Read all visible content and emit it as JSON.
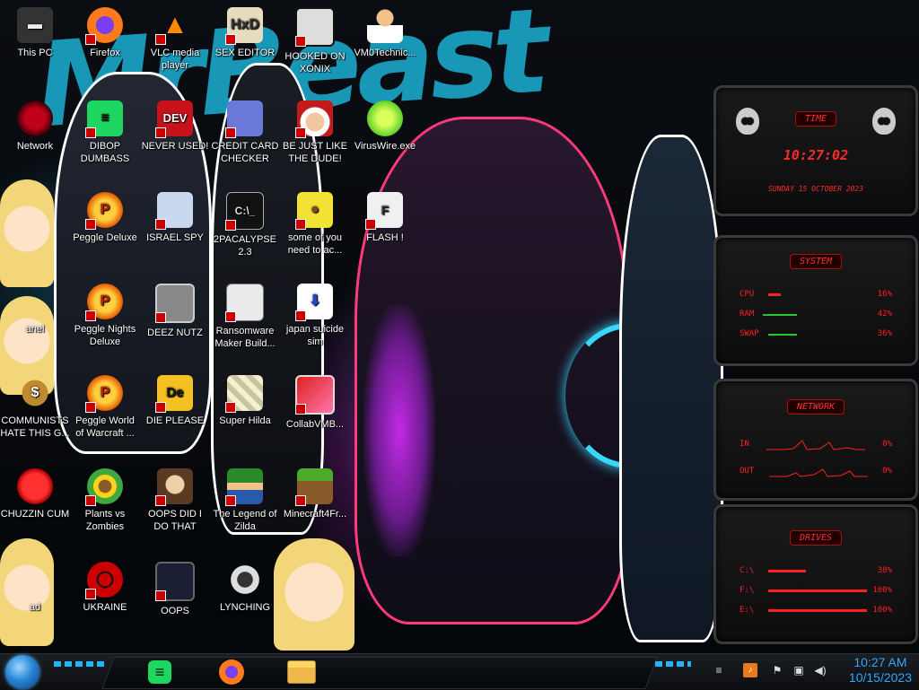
{
  "wallpaper": {
    "title_text": "MrBeast"
  },
  "desktop_icons": [
    {
      "id": "this-pc",
      "label": "This PC",
      "x": 0
    },
    {
      "id": "firefox",
      "label": "Firefox"
    },
    {
      "id": "vlc",
      "label": "VLC media player"
    },
    {
      "id": "sex-editor",
      "label": "SEX EDITOR"
    },
    {
      "id": "hooked-on-xonix",
      "label": "HOOKED ON XONIX"
    },
    {
      "id": "vm0technic",
      "label": "VM0Technic..."
    },
    {
      "id": "network",
      "label": "Network"
    },
    {
      "id": "dibop",
      "label": "DIBOP DUMBASS"
    },
    {
      "id": "never-used",
      "label": "NEVER USED!"
    },
    {
      "id": "credit-card",
      "label": "CREDIT CARD CHECKER"
    },
    {
      "id": "be-just-like",
      "label": "BE JUST LIKE THE DUDE!"
    },
    {
      "id": "viruswire",
      "label": "VirusWire.exe"
    },
    {
      "id": "peggle-deluxe",
      "label": "Peggle Deluxe"
    },
    {
      "id": "israel-spy",
      "label": "ISRAEL SPY"
    },
    {
      "id": "2pacalypse",
      "label": "2PACALYPSE 2.3"
    },
    {
      "id": "some-of-you",
      "label": "some of you need to ac..."
    },
    {
      "id": "flash",
      "label": "FLASH !"
    },
    {
      "id": "panel",
      "label": "anel"
    },
    {
      "id": "peggle-nights",
      "label": "Peggle Nights Deluxe"
    },
    {
      "id": "deez-nutz",
      "label": "DEEZ NUTZ"
    },
    {
      "id": "ransomware",
      "label": "Ransomware Maker Build..."
    },
    {
      "id": "japan-suicide",
      "label": "japan suicide sim"
    },
    {
      "id": "communists",
      "label": "COMMUNISTS HATE THIS G..."
    },
    {
      "id": "peggle-world",
      "label": "Peggle World of Warcraft ..."
    },
    {
      "id": "die-please",
      "label": "DIE PLEASE"
    },
    {
      "id": "super-hilda",
      "label": "Super Hilda"
    },
    {
      "id": "collabvmb",
      "label": "CollabVMB..."
    },
    {
      "id": "chuzzin",
      "label": "CHUZZIN CUM"
    },
    {
      "id": "pvz",
      "label": "Plants vs Zombies"
    },
    {
      "id": "oops-did",
      "label": "OOPS DID I DO THAT"
    },
    {
      "id": "zilda",
      "label": "The Legend of Zilda"
    },
    {
      "id": "minecraft",
      "label": "Minecraft4Fr..."
    },
    {
      "id": "ad",
      "label": "ad"
    },
    {
      "id": "ukraine",
      "label": "UKRAINE"
    },
    {
      "id": "oops",
      "label": "OOPS"
    },
    {
      "id": "lynching",
      "label": "LYNCHING"
    }
  ],
  "gadgets": {
    "time": {
      "title": "TIME",
      "clock": "10:27:02",
      "date": "SUNDAY 15 OCTOBER 2023"
    },
    "system": {
      "title": "SYSTEM",
      "rows": [
        {
          "label": "CPU",
          "value": "16%",
          "fill": 0.16
        },
        {
          "label": "RAM",
          "value": "42%",
          "fill": 0.42
        },
        {
          "label": "SWAP",
          "value": "36%",
          "fill": 0.36
        }
      ]
    },
    "network": {
      "title": "NETWORK",
      "rows": [
        {
          "label": "IN",
          "value": "0%"
        },
        {
          "label": "OUT",
          "value": "0%"
        }
      ]
    },
    "drives": {
      "title": "DRIVES",
      "rows": [
        {
          "label": "C:\\",
          "value": "38%",
          "fill": 0.38
        },
        {
          "label": "F:\\",
          "value": "100%",
          "fill": 1.0
        },
        {
          "label": "E:\\",
          "value": "100%",
          "fill": 1.0
        }
      ]
    }
  },
  "taskbar": {
    "apps": [
      "spotify-like-app",
      "firefox",
      "file-explorer"
    ],
    "clock_time": "10:27 AM",
    "clock_date": "10/15/2023"
  },
  "colors": {
    "accent_red": "#ff2020",
    "wallpaper_cyan": "#1aa7c9",
    "clock_blue": "#2fa8ff"
  }
}
